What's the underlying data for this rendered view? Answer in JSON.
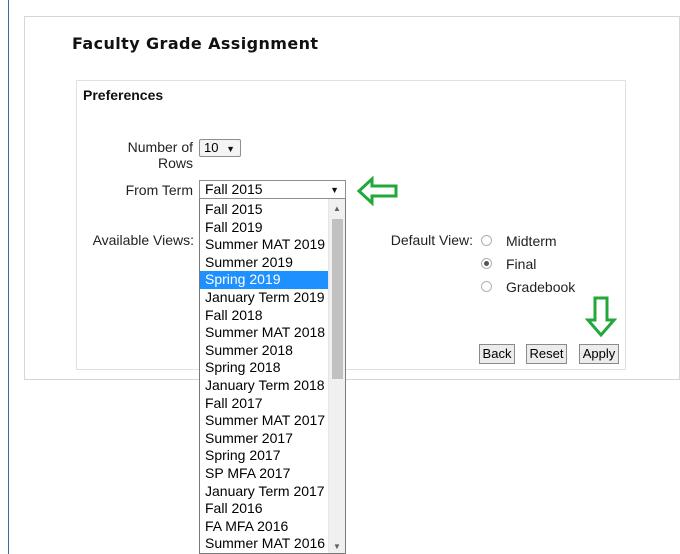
{
  "page": {
    "title": "Faculty Grade Assignment"
  },
  "preferences": {
    "section_title": "Preferences",
    "rows_label_line1": "Number of",
    "rows_label_line2": "Rows",
    "rows_value": "10",
    "from_term_label": "From Term",
    "from_term_value": "Fall 2015",
    "available_views_label": "Available Views:",
    "default_view_label": "Default View:"
  },
  "term_dropdown": {
    "selected": "Spring 2019",
    "options": [
      "Fall 2015",
      "Fall 2019",
      "Summer MAT 2019",
      "Summer 2019",
      "Spring 2019",
      "January Term 2019",
      "Fall 2018",
      "Summer MAT 2018",
      "Summer 2018",
      "Spring 2018",
      "January Term 2018",
      "Fall 2017",
      "Summer MAT 2017",
      "Summer 2017",
      "Spring 2017",
      "SP MFA 2017",
      "January Term 2017",
      "Fall 2016",
      "FA MFA 2016",
      "Summer MAT 2016"
    ]
  },
  "default_view": {
    "options": [
      "Midterm",
      "Final",
      "Gradebook"
    ],
    "selected": "Final"
  },
  "buttons": {
    "back": "Back",
    "reset": "Reset",
    "apply": "Apply"
  },
  "colors": {
    "highlight": "#1e90ff",
    "annotation_arrow": "#22a83a"
  },
  "icons": {
    "select_caret": "▼",
    "scroll_up": "▲",
    "scroll_down": "▼",
    "annotation_left": "arrow-left-outline",
    "annotation_down": "arrow-down-outline"
  }
}
